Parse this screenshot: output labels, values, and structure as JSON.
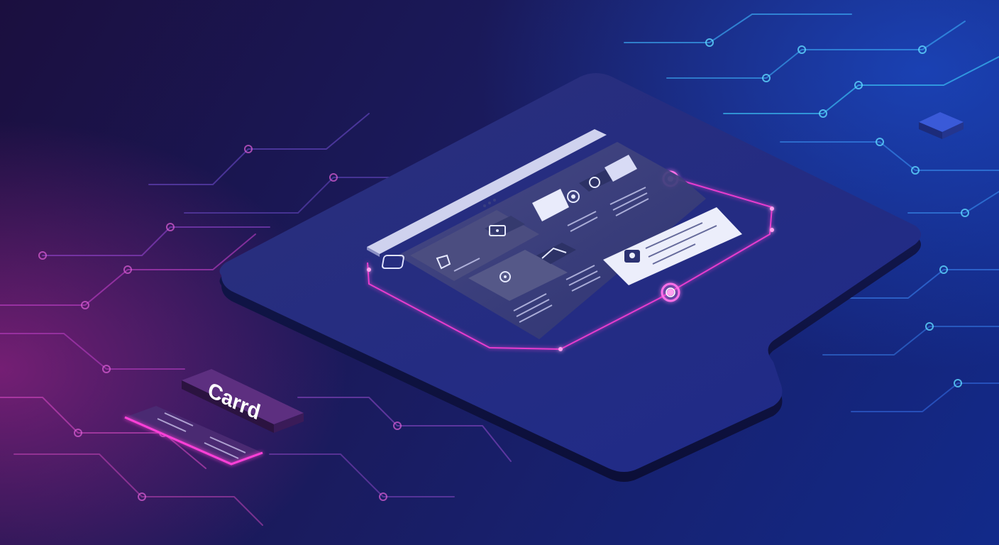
{
  "brand": {
    "wordmark": "Carrd"
  },
  "colors": {
    "accent_pink": "#ff3fd8",
    "accent_cyan": "#3fd2ff",
    "panel": "#2a3378",
    "screen_card": "#3a4070"
  },
  "icons": [
    "shield-icon",
    "gear-icon",
    "settings-icon",
    "image-icon",
    "chart-icon",
    "location-pin-icon",
    "profile-icon",
    "target-icon"
  ]
}
